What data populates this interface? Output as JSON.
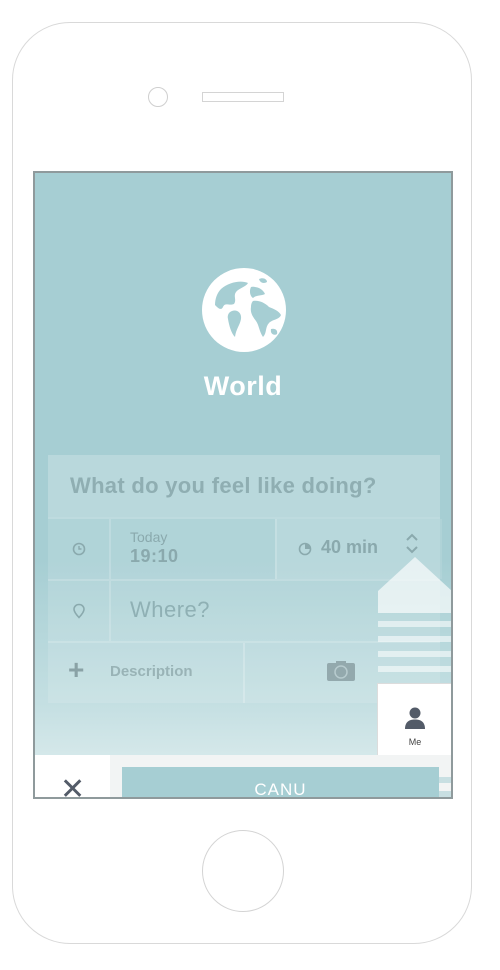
{
  "header": {
    "title": "World"
  },
  "form": {
    "question_placeholder": "What do you feel like doing?",
    "when": {
      "day": "Today",
      "time": "19:10"
    },
    "duration": "40 min",
    "where_placeholder": "Where?",
    "description_label": "Description"
  },
  "actions": {
    "submit_label": "CANU",
    "close_symbol": "✕"
  },
  "nav": {
    "me_label": "Me"
  },
  "colors": {
    "accent": "#a6ced3",
    "dark_icon": "#535b68"
  }
}
